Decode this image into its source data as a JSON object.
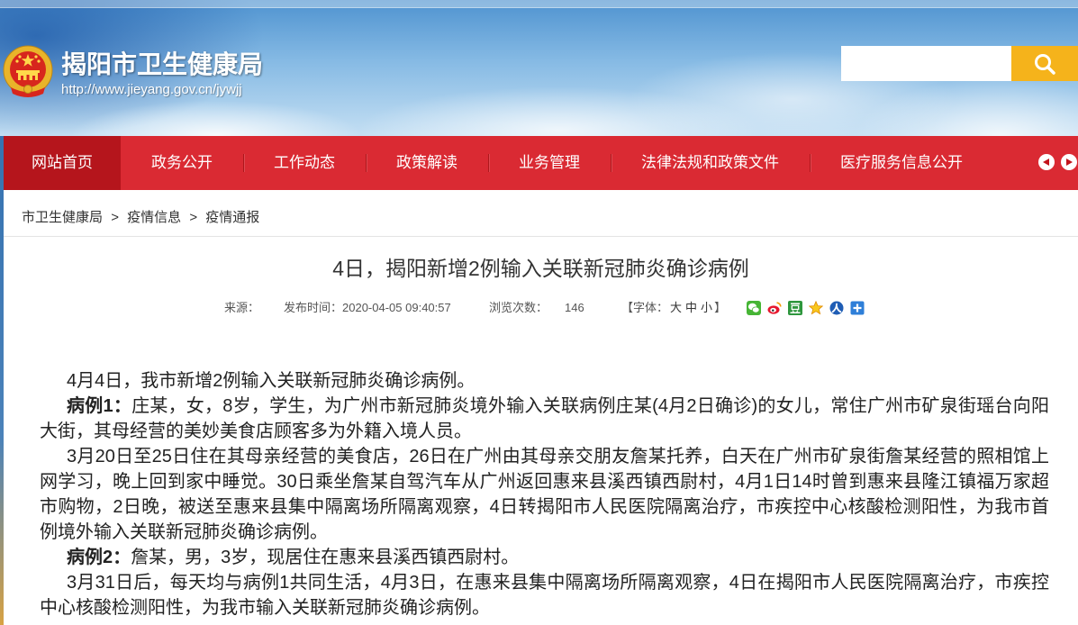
{
  "header": {
    "site_title": "揭阳市卫生健康局",
    "site_url": "http://www.jieyang.gov.cn/jywjj",
    "emblem_icon": "national-emblem-icon",
    "search": {
      "value": "",
      "placeholder": "",
      "button_icon": "search-icon"
    }
  },
  "nav": {
    "active_index": 0,
    "items": [
      {
        "label": "网站首页"
      },
      {
        "label": "政务公开"
      },
      {
        "label": "工作动态"
      },
      {
        "label": "政策解读"
      },
      {
        "label": "业务管理"
      },
      {
        "label": "法律法规和政策文件"
      },
      {
        "label": "医疗服务信息公开"
      }
    ],
    "prev_icon": "chevron-left-icon",
    "next_icon": "chevron-right-icon"
  },
  "breadcrumb": {
    "separator": ">",
    "items": [
      "市卫生健康局",
      "疫情信息",
      "疫情通报"
    ]
  },
  "article": {
    "title": "4日，揭阳新增2例输入关联新冠肺炎确诊病例",
    "meta": {
      "source_label": "来源：",
      "publish_label": "发布时间：",
      "publish_time": "2020-04-05 09:40:57",
      "views_label": "浏览次数：",
      "views": "146",
      "font_label_open": "【字体：",
      "font_sizes": [
        "大",
        "中",
        "小"
      ],
      "font_label_close": "】"
    },
    "share_icons": [
      "wechat-icon",
      "weibo-icon",
      "douban-icon",
      "qzone-star-icon",
      "renren-icon",
      "more-share-icon"
    ],
    "paragraphs": [
      {
        "text": "4月4日，我市新增2例输入关联新冠肺炎确诊病例。"
      },
      {
        "lead": "病例1：",
        "text": "庄某，女，8岁，学生，为广州市新冠肺炎境外输入关联病例庄某(4月2日确诊)的女儿，常住广州市矿泉街瑶台向阳大街，其母经营的美妙美食店顾客多为外籍入境人员。"
      },
      {
        "text": "3月20日至25日住在其母亲经营的美食店，26日在广州由其母亲交朋友詹某托养，白天在广州市矿泉街詹某经营的照相馆上网学习，晚上回到家中睡觉。30日乘坐詹某自驾汽车从广州返回惠来县溪西镇西尉村，4月1日14时曾到惠来县隆江镇福万家超市购物，2日晚，被送至惠来县集中隔离场所隔离观察，4日转揭阳市人民医院隔离治疗，市疾控中心核酸检测阳性，为我市首例境外输入关联新冠肺炎确诊病例。"
      },
      {
        "lead": "病例2：",
        "text": "詹某，男，3岁，现居住在惠来县溪西镇西尉村。"
      },
      {
        "text": "3月31日后，每天均与病例1共同生活，4月3日，在惠来县集中隔离场所隔离观察，4日在揭阳市人民医院隔离治疗，市疾控中心核酸检测阳性，为我市输入关联新冠肺炎确诊病例。"
      }
    ]
  },
  "colors": {
    "nav_red": "#da2a33",
    "nav_active": "#b5151c",
    "search_button": "#f5b31b",
    "text": "#333333"
  }
}
